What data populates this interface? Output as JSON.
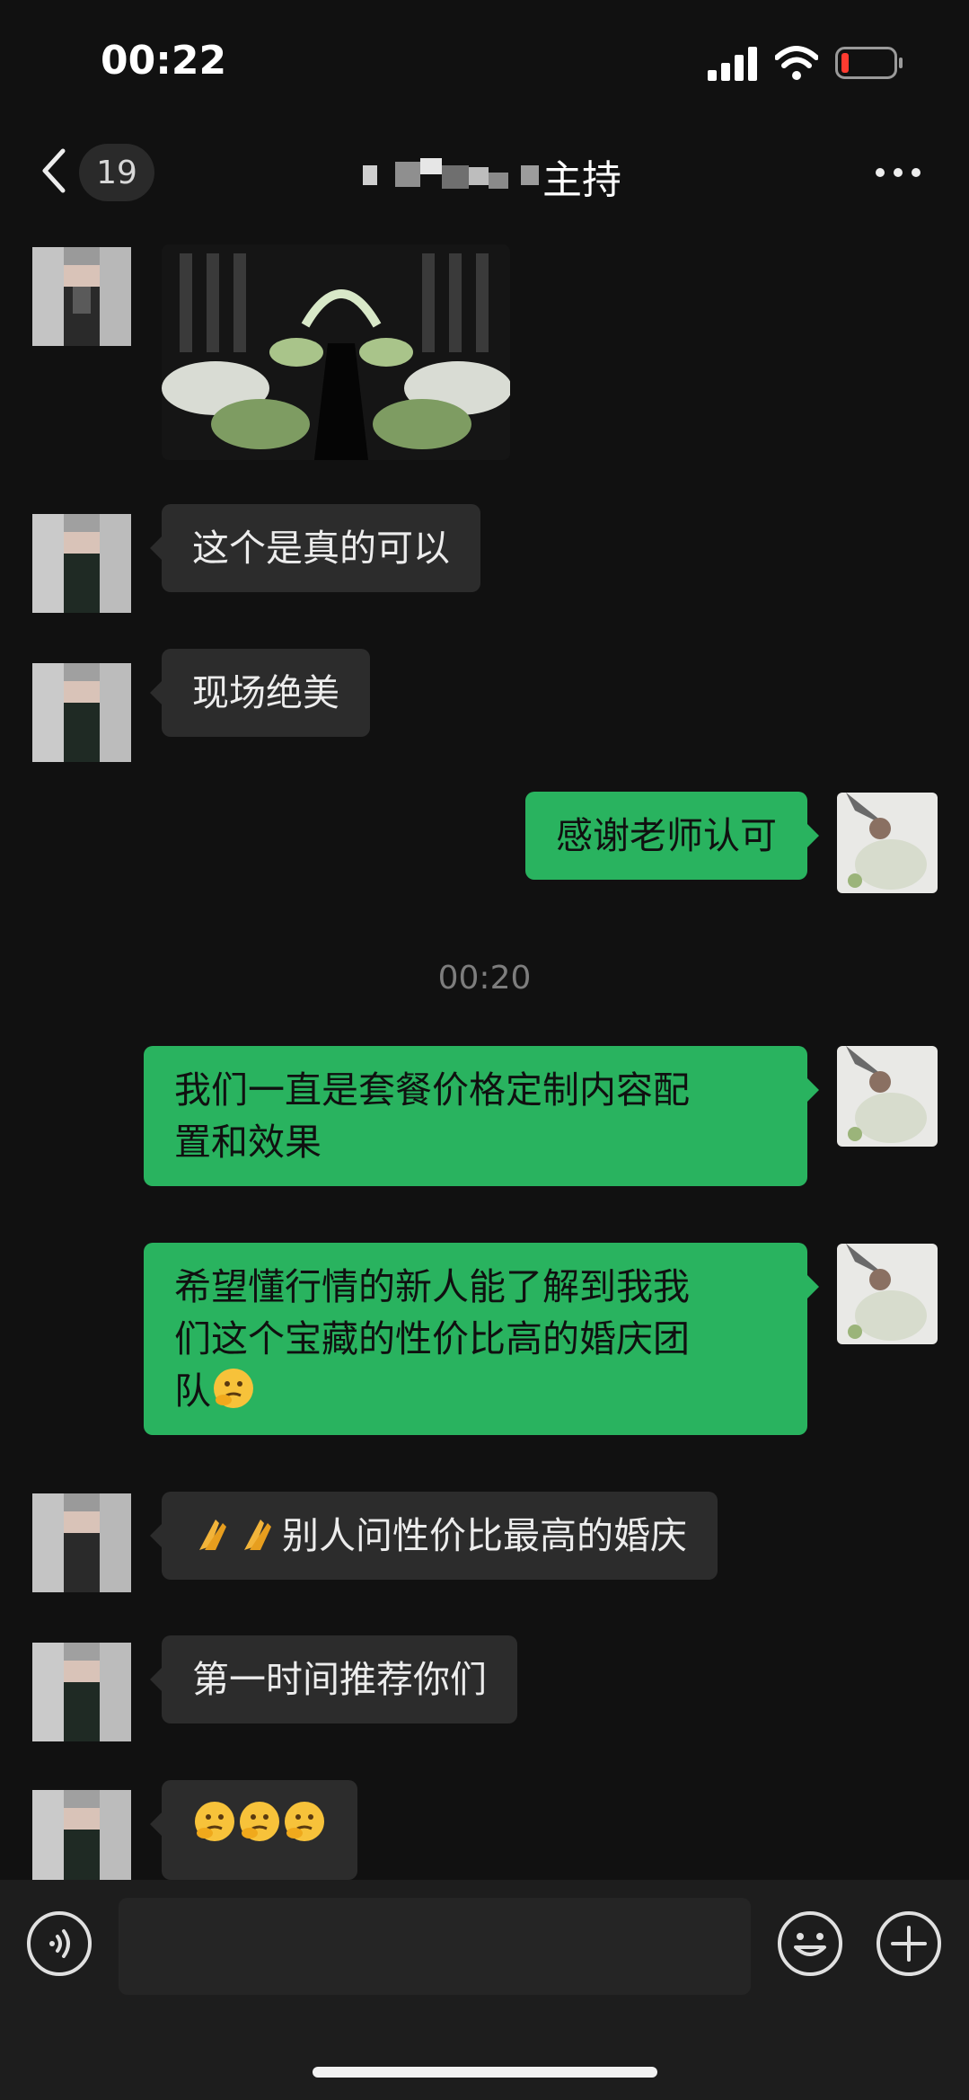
{
  "status": {
    "time": "00:22"
  },
  "nav": {
    "unread_count": "19",
    "title": "主持"
  },
  "messages": [
    {
      "type": "image",
      "side": "left"
    },
    {
      "side": "left",
      "text": "这个是真的可以"
    },
    {
      "side": "left",
      "text": "现场绝美"
    },
    {
      "side": "right",
      "text": "感谢老师认可"
    },
    {
      "type": "timestamp",
      "text": "00:20"
    },
    {
      "side": "right",
      "lines": [
        "我们一直是套餐价格定制内容配",
        "置和效果"
      ]
    },
    {
      "side": "right",
      "lines": [
        "希望懂行情的新人能了解到我我",
        "们这个宝藏的性价比高的婚庆团",
        "队"
      ],
      "emoji": [
        "thinking-face"
      ]
    },
    {
      "side": "left",
      "text": "别人问性价比最高的婚庆",
      "emoji": [
        "folded-hands",
        "folded-hands"
      ]
    },
    {
      "side": "left",
      "text": "第一时间推荐你们"
    },
    {
      "side": "left",
      "emoji": [
        "thinking-face",
        "thinking-face",
        "thinking-face"
      ]
    }
  ],
  "icons": [
    "back-chevron-icon",
    "more-icon",
    "voice-icon",
    "emoji-icon",
    "plus-icon"
  ],
  "colors": {
    "background": "#111111",
    "incoming_bubble": "#2c2c2c",
    "outgoing_bubble": "#29b35f",
    "battery_low": "#ff3b30"
  }
}
